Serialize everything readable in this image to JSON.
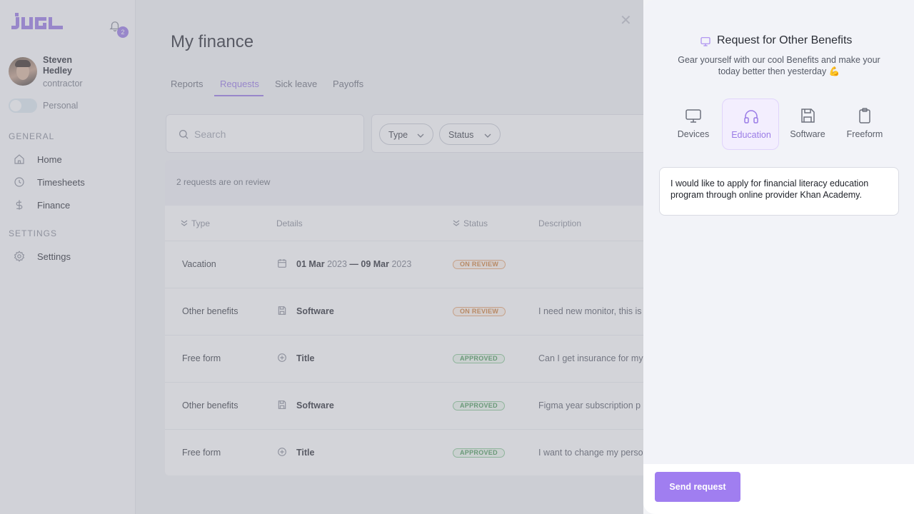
{
  "app": {
    "logo_text": "JUGL",
    "notifications_count": "2"
  },
  "user": {
    "name": "Steven Hedley",
    "role": "contractor",
    "toggle_label": "Personal"
  },
  "sidebar": {
    "general_label": "GENERAL",
    "settings_label": "SETTINGS",
    "items": [
      {
        "label": "Home",
        "icon": "home-icon"
      },
      {
        "label": "Timesheets",
        "icon": "clock-icon"
      },
      {
        "label": "Finance",
        "icon": "dollar-icon"
      },
      {
        "label": "Settings",
        "icon": "gear-icon"
      }
    ]
  },
  "main": {
    "title": "My finance",
    "tabs": [
      {
        "label": "Reports"
      },
      {
        "label": "Requests"
      },
      {
        "label": "Sick leave"
      },
      {
        "label": "Payoffs"
      }
    ],
    "search_placeholder": "Search",
    "filters": {
      "type_label": "Type",
      "status_label": "Status"
    },
    "review_text": "2 requests are on review",
    "columns": {
      "type": "Type",
      "details": "Details",
      "status": "Status",
      "description": "Description"
    },
    "rows": [
      {
        "type": "Vacation",
        "detail_icon": "calendar-icon",
        "date_start_day": "01 Mar",
        "date_start_year": "2023",
        "dash": "—",
        "date_end_day": "09 Mar",
        "date_end_year": "2023",
        "status": "ON REVIEW",
        "description": ""
      },
      {
        "type": "Other benefits",
        "detail_icon": "floppy-icon",
        "detail": "Software",
        "status": "ON REVIEW",
        "description": "I need new monitor, this is"
      },
      {
        "type": "Free form",
        "detail_icon": "plus-circle-icon",
        "detail": "Title",
        "status": "APPROVED",
        "description": "Can I get insurance for my"
      },
      {
        "type": "Other benefits",
        "detail_icon": "floppy-icon",
        "detail": "Software",
        "status": "APPROVED",
        "description": "Figma year subscription p"
      },
      {
        "type": "Free form",
        "detail_icon": "plus-circle-icon",
        "detail": "Title",
        "status": "APPROVED",
        "description": "I want to change my perso"
      }
    ]
  },
  "panel": {
    "title": "Request for Other Benefits",
    "subtitle": "Gear yourself with our cool Benefits and make your today better then yesterday 💪",
    "options": [
      {
        "label": "Devices",
        "icon": "monitor-icon"
      },
      {
        "label": "Education",
        "icon": "headphones-icon"
      },
      {
        "label": "Software",
        "icon": "floppy-icon"
      },
      {
        "label": "Freeform",
        "icon": "clipboard-icon"
      }
    ],
    "text_value": "I would like to apply for financial literacy education program through online provider Khan Academy.",
    "send_label": "Send request"
  },
  "colors": {
    "accent": "#9a7be6",
    "review": "#d1803a",
    "approved": "#4a9a58"
  }
}
